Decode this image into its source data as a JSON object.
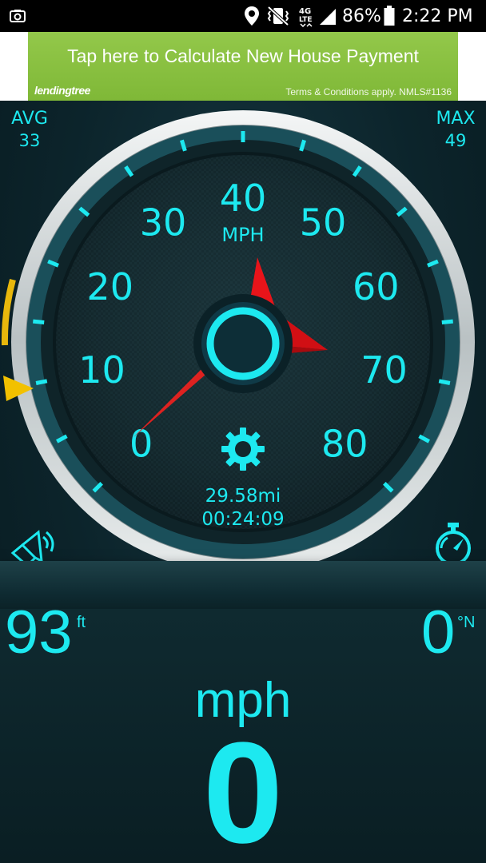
{
  "status_bar": {
    "battery_percent": "86%",
    "time": "2:22 PM",
    "icons": [
      "picture-notification-icon",
      "location-icon",
      "vibrate-mute-icon",
      "lte-4g-icon",
      "signal-icon",
      "battery-icon"
    ]
  },
  "ad": {
    "title": "Tap here to Calculate New House Payment",
    "logo_text": "lendingtree",
    "terms": "Terms & Conditions apply. NMLS#1136",
    "background_color": "#86bf3f"
  },
  "stats": {
    "avg_label": "AVG",
    "avg_value": "33",
    "max_label": "MAX",
    "max_value": "49"
  },
  "gauge": {
    "unit": "MPH",
    "ticks": [
      "0",
      "10",
      "20",
      "30",
      "40",
      "50",
      "60",
      "70",
      "80"
    ],
    "distance": "29.58mi",
    "elapsed_time": "00:24:09",
    "needle_color": "#e8141a",
    "accent_color": "#1de9f0"
  },
  "readouts": {
    "altitude_value": "93",
    "altitude_unit": "ft",
    "heading_value": "0",
    "heading_unit": "°N",
    "speed_unit": "mph",
    "speed_value": "0"
  }
}
